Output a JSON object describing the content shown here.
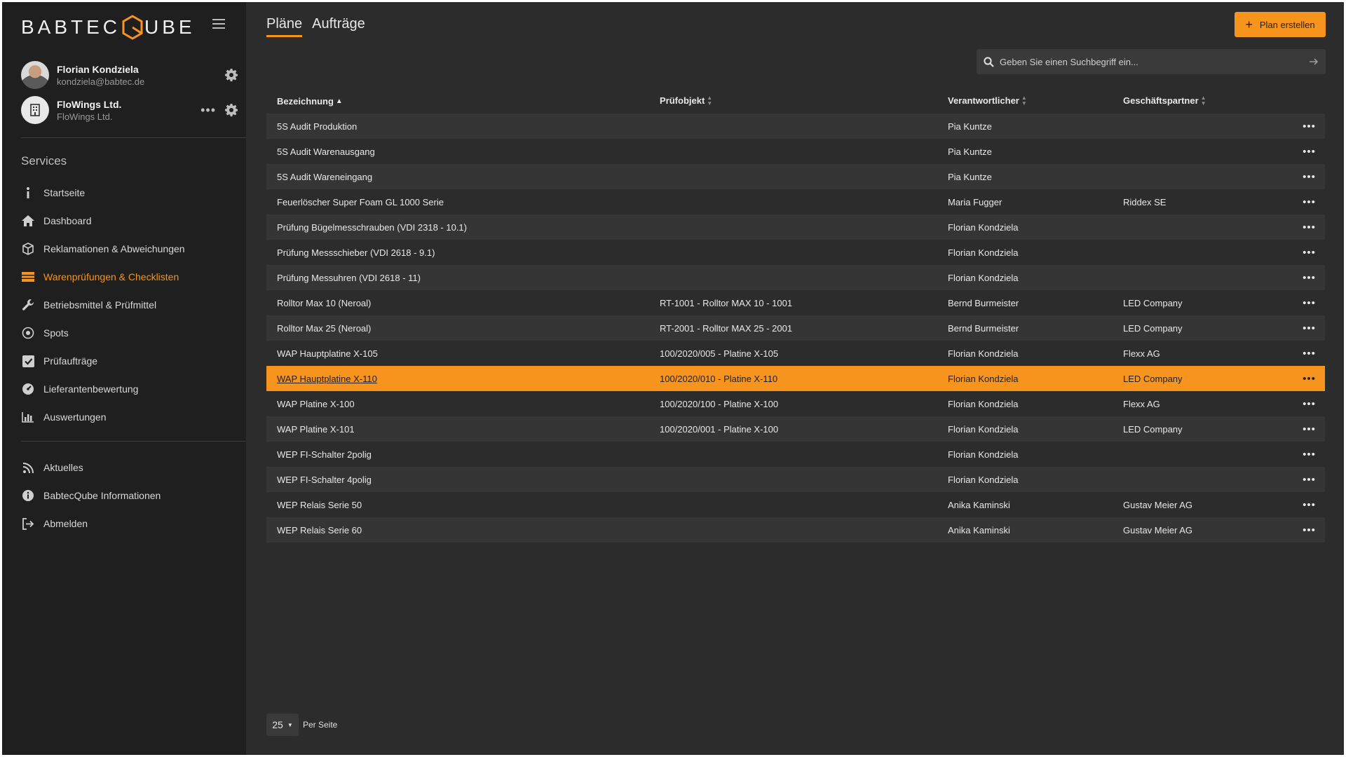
{
  "brand": {
    "name_left": "BABTEC",
    "name_right": "UBE"
  },
  "account": {
    "user_name": "Florian Kondziela",
    "user_email": "kondziela@babtec.de",
    "org_name": "FloWings Ltd.",
    "org_sub": "FloWings Ltd.",
    "more_label": "•••"
  },
  "sidebar": {
    "services_title": "Services",
    "items": [
      {
        "label": "Startseite",
        "icon": "info-icon"
      },
      {
        "label": "Dashboard",
        "icon": "home-icon"
      },
      {
        "label": "Reklamationen & Abweichungen",
        "icon": "cubes-icon"
      },
      {
        "label": "Warenprüfungen & Checklisten",
        "icon": "list-icon",
        "active": true
      },
      {
        "label": "Betriebsmittel & Prüfmittel",
        "icon": "wrench-icon"
      },
      {
        "label": "Spots",
        "icon": "target-icon"
      },
      {
        "label": "Prüfaufträge",
        "icon": "checkbox-icon"
      },
      {
        "label": "Lieferantenbewertung",
        "icon": "gauge-icon"
      },
      {
        "label": "Auswertungen",
        "icon": "bar-chart-icon"
      }
    ],
    "bottom_items": [
      {
        "label": "Aktuelles",
        "icon": "rss-icon"
      },
      {
        "label": "BabtecQube Informationen",
        "icon": "info-circle-icon"
      },
      {
        "label": "Abmelden",
        "icon": "logout-icon"
      }
    ]
  },
  "tabs": [
    {
      "label": "Pläne",
      "active": true
    },
    {
      "label": "Aufträge",
      "active": false
    }
  ],
  "create_button": {
    "label": "Plan erstellen"
  },
  "search": {
    "placeholder": "Geben Sie einen Suchbegriff ein..."
  },
  "table": {
    "columns": [
      "Bezeichnung",
      "Prüfobjekt",
      "Verantwortlicher",
      "Geschäftspartner"
    ],
    "rows": [
      {
        "name": "5S Audit Produktion",
        "object": "",
        "owner": "Pia Kuntze",
        "partner": ""
      },
      {
        "name": "5S Audit Warenausgang",
        "object": "",
        "owner": "Pia Kuntze",
        "partner": ""
      },
      {
        "name": "5S Audit Wareneingang",
        "object": "",
        "owner": "Pia Kuntze",
        "partner": ""
      },
      {
        "name": "Feuerlöscher Super Foam GL 1000 Serie",
        "object": "",
        "owner": "Maria Fugger",
        "partner": "Riddex SE"
      },
      {
        "name": "Prüfung Bügelmesschrauben (VDI 2318 - 10.1)",
        "object": "",
        "owner": "Florian Kondziela",
        "partner": ""
      },
      {
        "name": "Prüfung Messschieber (VDI 2618 - 9.1)",
        "object": "",
        "owner": "Florian Kondziela",
        "partner": ""
      },
      {
        "name": "Prüfung Messuhren (VDI 2618 - 11)",
        "object": "",
        "owner": "Florian Kondziela",
        "partner": ""
      },
      {
        "name": "Rolltor Max 10 (Neroal)",
        "object": "RT-1001 - Rolltor MAX 10 - 1001",
        "owner": "Bernd Burmeister",
        "partner": "LED Company"
      },
      {
        "name": "Rolltor Max 25 (Neroal)",
        "object": "RT-2001 - Rolltor MAX 25 - 2001",
        "owner": "Bernd Burmeister",
        "partner": "LED Company"
      },
      {
        "name": "WAP Hauptplatine X-105",
        "object": "100/2020/005 - Platine X-105",
        "owner": "Florian Kondziela",
        "partner": "Flexx AG"
      },
      {
        "name": "WAP Hauptplatine X-110",
        "object": "100/2020/010 - Platine X-110",
        "owner": "Florian Kondziela",
        "partner": "LED Company",
        "selected": true
      },
      {
        "name": "WAP Platine X-100",
        "object": "100/2020/100 - Platine X-100",
        "owner": "Florian Kondziela",
        "partner": "Flexx AG"
      },
      {
        "name": "WAP Platine X-101",
        "object": "100/2020/001 - Platine X-100",
        "owner": "Florian Kondziela",
        "partner": "LED Company"
      },
      {
        "name": "WEP FI-Schalter 2polig",
        "object": "",
        "owner": "Florian Kondziela",
        "partner": ""
      },
      {
        "name": "WEP FI-Schalter 4polig",
        "object": "",
        "owner": "Florian Kondziela",
        "partner": ""
      },
      {
        "name": "WEP Relais Serie 50",
        "object": "",
        "owner": "Anika Kaminski",
        "partner": "Gustav Meier AG"
      },
      {
        "name": "WEP Relais Serie 60",
        "object": "",
        "owner": "Anika Kaminski",
        "partner": "Gustav Meier AG"
      }
    ],
    "row_menu_label": "•••"
  },
  "pager": {
    "per_page_value": "25",
    "per_page_label": "Per Seite"
  },
  "colors": {
    "accent": "#f7941d",
    "sidebar_bg": "#1f1f1f",
    "main_bg": "#2c2c2c",
    "row_alt": "#353535"
  }
}
